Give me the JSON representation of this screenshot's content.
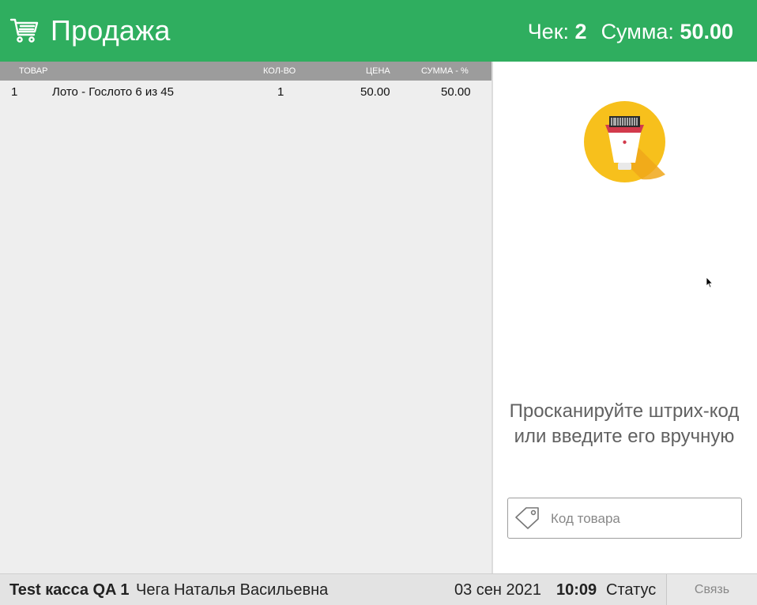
{
  "header": {
    "icon": "shopping-cart-icon",
    "title": "Продажа",
    "check_label": "Чек:",
    "check_number": "2",
    "sum_label": "Сумма:",
    "sum_value": "50.00",
    "background_color": "#2fae5f"
  },
  "table": {
    "columns": [
      "ТОВАР",
      "КОЛ-ВО",
      "ЦЕНА",
      "СУММА - %"
    ],
    "rows": [
      {
        "num": "1",
        "name": "Лото - Гослото 6 из 45",
        "qty": "1",
        "price": "50.00",
        "sum": "50.00"
      }
    ]
  },
  "scan": {
    "icon": "barcode-scanner-icon",
    "prompt": "Просканируйте штрих-код или введите его вручную",
    "input_icon": "tag-icon",
    "input_placeholder": "Код товара",
    "input_value": ""
  },
  "statusbar": {
    "till": "Test касса QA 1",
    "user": "Чега Наталья Васильевна",
    "date": "03 сен 2021",
    "time": "10:09",
    "status": "Статус",
    "link": "Связь"
  }
}
